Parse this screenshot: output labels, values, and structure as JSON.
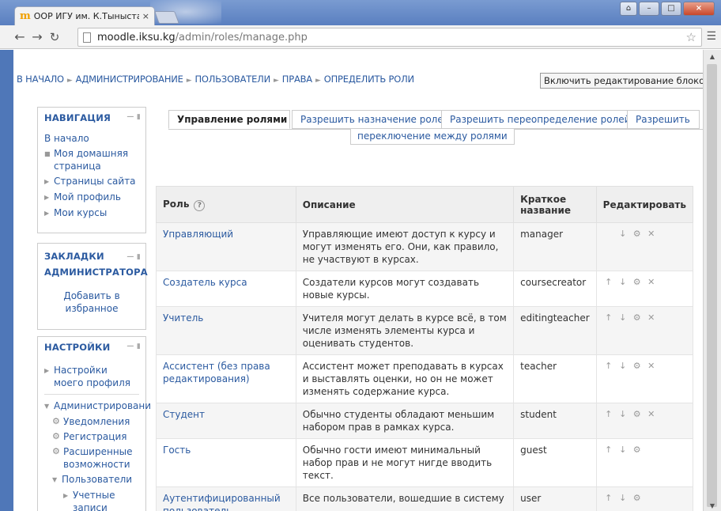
{
  "browser": {
    "tab_title": "ООР ИГУ им. К.Тыныстан",
    "tab_close": "×",
    "favicon": "m",
    "url_host": "moodle.iksu.kg",
    "url_path": "/admin/roles/manage.php",
    "win_user": "⌂",
    "win_min": "–",
    "win_max": "□",
    "win_close": "×"
  },
  "breadcrumb": [
    "В НАЧАЛО",
    "АДМИНИСТРИРОВАНИЕ",
    "ПОЛЬЗОВАТЕЛИ",
    "ПРАВА",
    "ОПРЕДЕЛИТЬ РОЛИ"
  ],
  "edit_blocks_button": "Включить редактирование блоков",
  "navigation_block": {
    "title": "НАВИГАЦИЯ",
    "home": "В начало",
    "items": [
      "Моя домашняя страница",
      "Страницы сайта",
      "Мой профиль",
      "Мои курсы"
    ]
  },
  "bookmarks_block": {
    "title": "ЗАКЛАДКИ АДМИНИСТРАТОРА",
    "link": "Добавить в избранное"
  },
  "settings_block": {
    "title": "НАСТРОЙКИ",
    "profile": "Настройки моего профиля",
    "admin": "Администрировани",
    "notifications": "Уведомления",
    "registration": "Регистрация",
    "advanced": "Расширенные возможности",
    "users": "Пользователи",
    "accounts": "Учетные записи"
  },
  "tabs": {
    "manage": "Управление ролями",
    "assign": "Разрешить назначение ролей",
    "override": "Разрешить переопределение ролей",
    "allow": "Разрешить",
    "switch": "переключение между ролями"
  },
  "table": {
    "headers": {
      "role": "Роль",
      "description": "Описание",
      "short_name": "Краткое название",
      "edit": "Редактировать"
    },
    "help_icon": "?",
    "rows": [
      {
        "role": "Управляющий",
        "description": "Управляющие имеют доступ к курсу и могут изменять его. Они, как правило, не участвуют в курсах.",
        "short": "manager",
        "up": false,
        "down": true,
        "delete": true
      },
      {
        "role": "Создатель курса",
        "description": "Создатели курсов могут создавать новые курсы.",
        "short": "coursecreator",
        "up": true,
        "down": true,
        "delete": true
      },
      {
        "role": "Учитель",
        "description": "Учителя могут делать в курсе всё, в том числе изменять элементы курса и оценивать студентов.",
        "short": "editingteacher",
        "up": true,
        "down": true,
        "delete": true
      },
      {
        "role": "Ассистент (без права редактирования)",
        "description": "Ассистент может преподавать в курсах и выставлять оценки, но он не может изменять содержание курса.",
        "short": "teacher",
        "up": true,
        "down": true,
        "delete": true
      },
      {
        "role": "Студент",
        "description": "Обычно студенты обладают меньшим набором прав в рамках курса.",
        "short": "student",
        "up": true,
        "down": true,
        "delete": true
      },
      {
        "role": "Гость",
        "description": "Обычно гости имеют минимальный набор прав и не могут нигде вводить текст.",
        "short": "guest",
        "up": true,
        "down": true,
        "delete": false
      },
      {
        "role": "Аутентифицированный пользователь",
        "description": "Все пользователи, вошедшие в систему",
        "short": "user",
        "up": true,
        "down": true,
        "delete": false
      }
    ]
  },
  "icons": {
    "up": "arrow-up-icon",
    "down": "arrow-down-icon",
    "settings": "gear-icon",
    "delete": "delete-icon"
  },
  "colors": {
    "link": "#2b5aa0",
    "header_bg": "#efefef"
  }
}
